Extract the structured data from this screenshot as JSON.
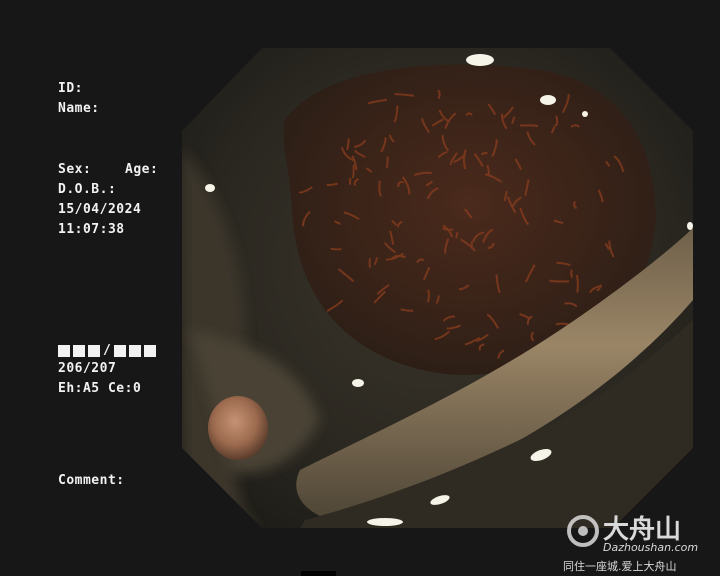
{
  "patient_info": {
    "id_label": "ID:",
    "name_label": "Name:",
    "sex_label": "Sex:",
    "age_label": "Age:",
    "dob_label": "D.O.B.:",
    "date": "15/04/2024",
    "time": "11:07:38"
  },
  "counter": {
    "blocks_text": "■■■/■■■",
    "frame": "206/207",
    "settings": "Eh:A5 Ce:0"
  },
  "comment_label": "Comment:",
  "watermark": {
    "brand": "大舟山",
    "url": "Dazhoushan.com",
    "slogan": "同住一座城.爱上大舟山"
  },
  "colors": {
    "background": "#171717",
    "text": "#f2f2f2",
    "mucosa_dark": "#2e2a22",
    "mucosa_red": "#7a3418",
    "fold_tan": "#8a7557"
  }
}
